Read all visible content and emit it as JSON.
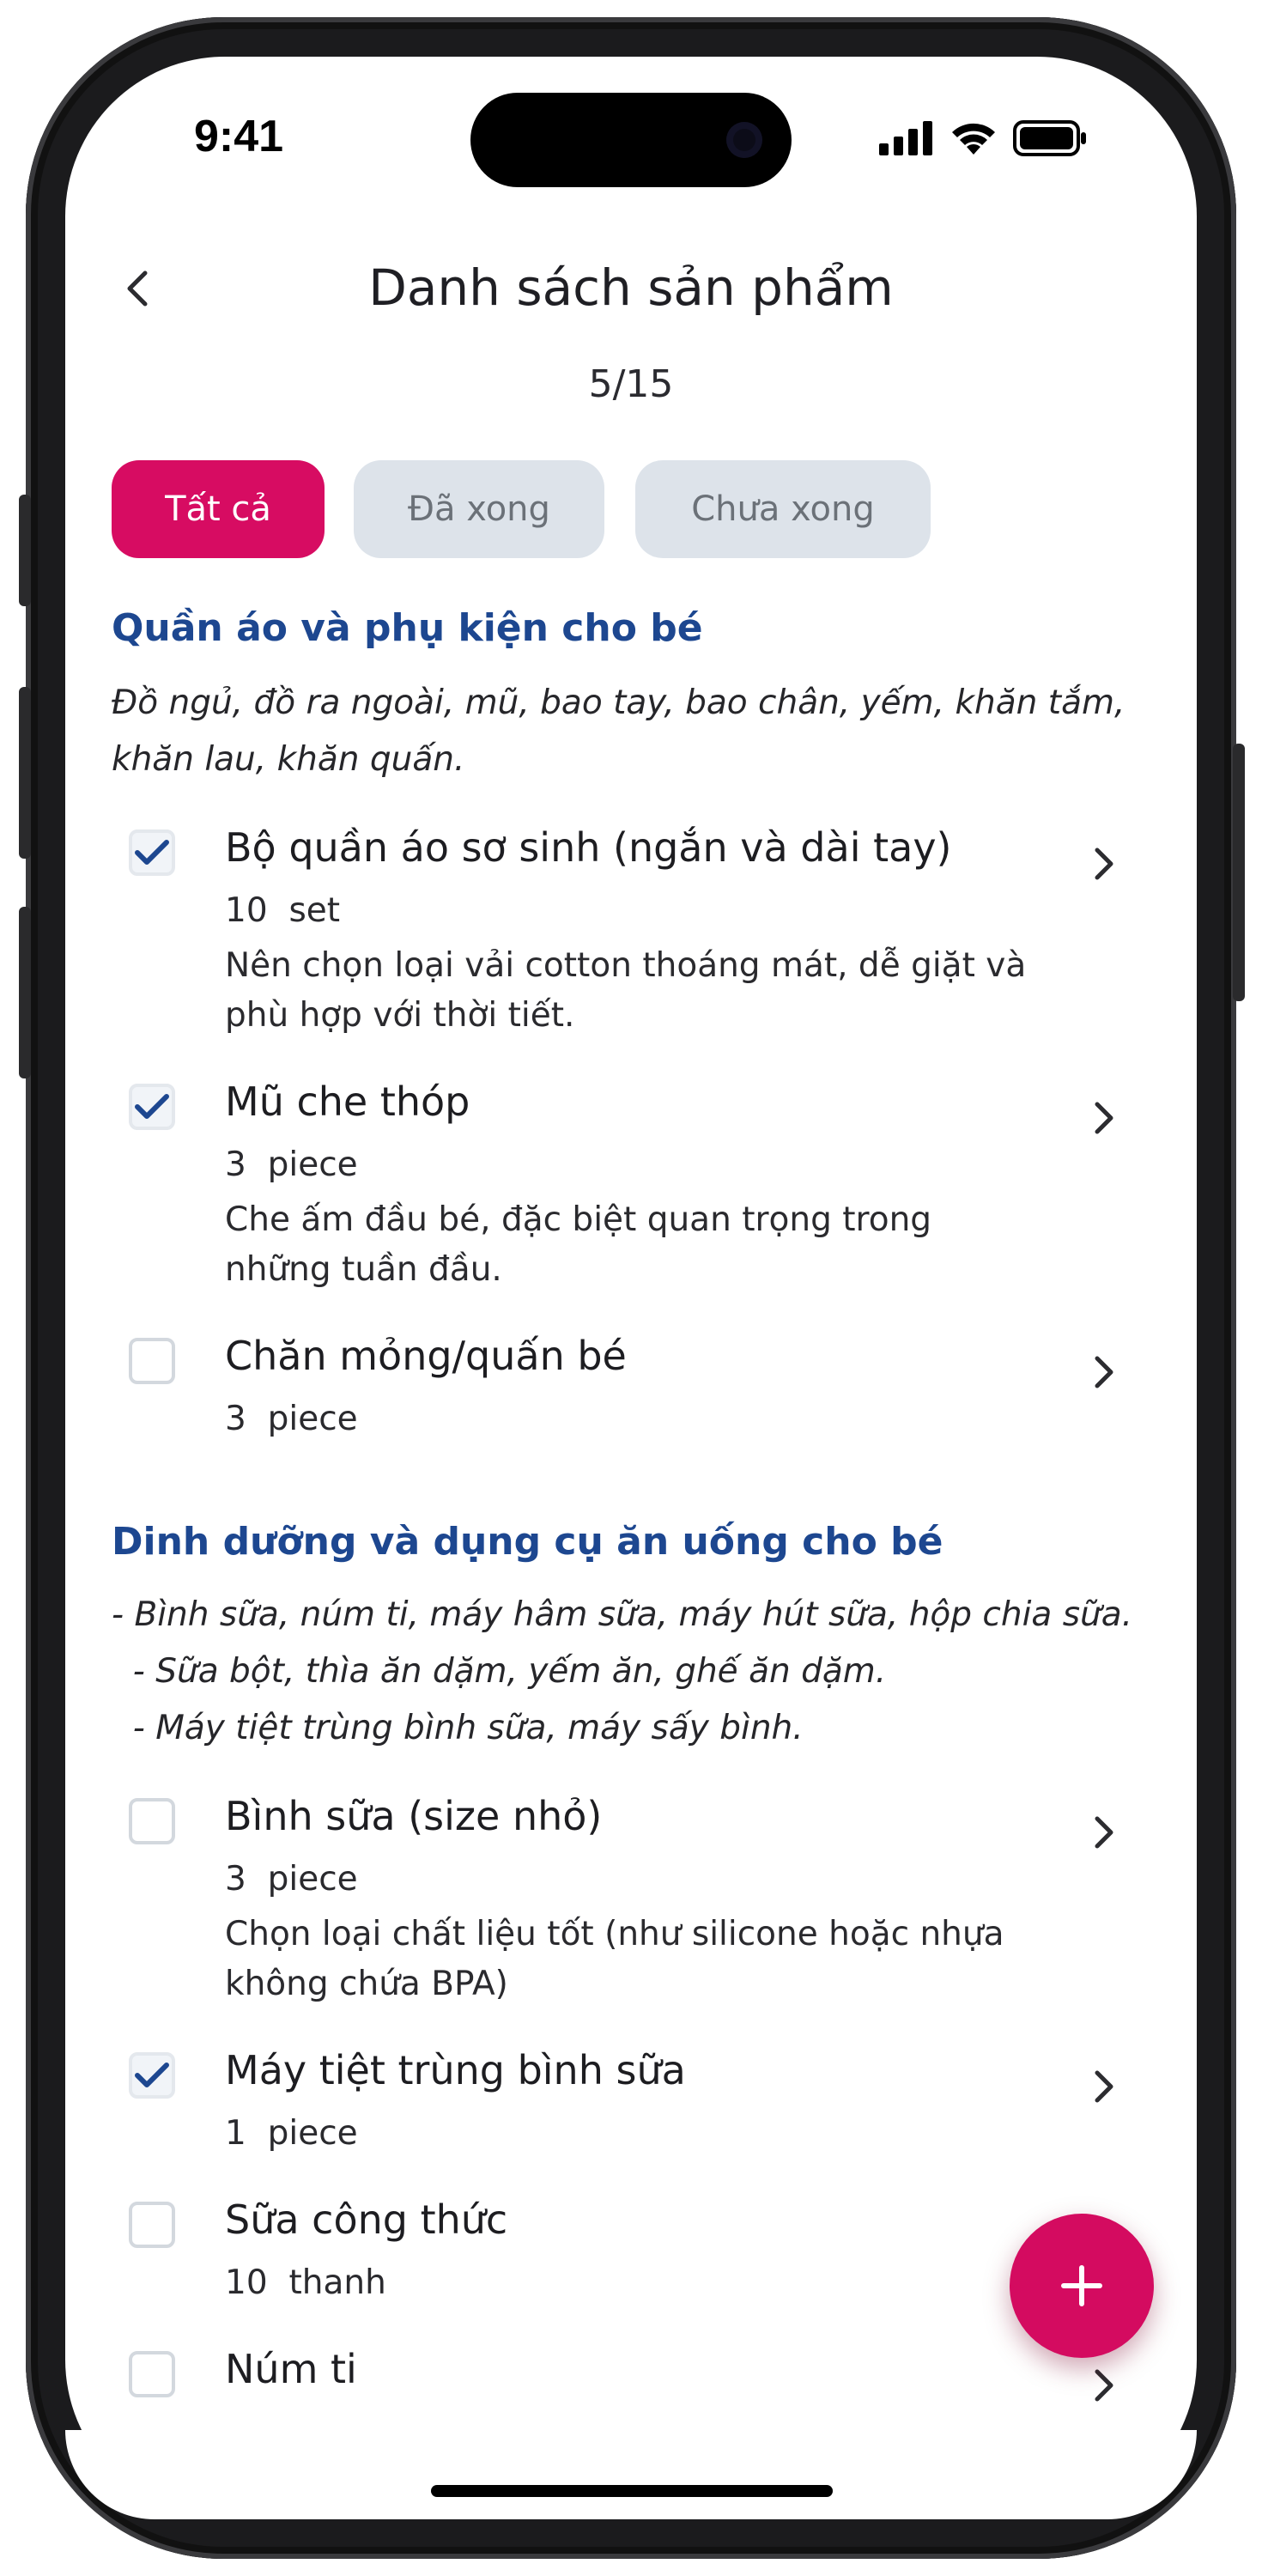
{
  "status_bar": {
    "time": "9:41"
  },
  "header": {
    "title": "Danh sách sản phẩm",
    "progress": "5/15"
  },
  "tabs": [
    {
      "label": "Tất cả",
      "active": true
    },
    {
      "label": "Đã xong",
      "active": false
    },
    {
      "label": "Chưa xong",
      "active": false
    }
  ],
  "sections": [
    {
      "title": "Quần áo và phụ kiện cho bé",
      "description_lines": [
        "Đồ ngủ, đồ ra ngoài, mũ, bao tay, bao chân, yếm, khăn tắm,",
        "khăn lau, khăn quấn."
      ],
      "items": [
        {
          "name": "Bộ quần áo sơ sinh (ngắn và dài tay)",
          "qty": "10",
          "unit": "set",
          "checked": true,
          "note_lines": [
            "Nên chọn loại vải cotton thoáng mát, dễ giặt và",
            "phù hợp với thời tiết."
          ]
        },
        {
          "name": "Mũ che thóp",
          "qty": "3",
          "unit": "piece",
          "checked": true,
          "note_lines": [
            "Che ấm đầu bé, đặc biệt quan trọng trong",
            "những tuần đầu."
          ]
        },
        {
          "name": "Chăn mỏng/quấn bé",
          "qty": "3",
          "unit": "piece",
          "checked": false,
          "note_lines": []
        }
      ]
    },
    {
      "title": "Dinh dưỡng và dụng cụ ăn uống cho bé",
      "description_lines": [
        "- Bình sữa, núm ti, máy hâm sữa, máy hút sữa, hộp chia sữa.",
        "  - Sữa bột, thìa ăn dặm, yếm ăn, ghế ăn dặm.",
        "  - Máy tiệt trùng bình sữa, máy sấy bình."
      ],
      "items": [
        {
          "name": "Bình sữa (size nhỏ)",
          "qty": "3",
          "unit": "piece",
          "checked": false,
          "note_lines": [
            "Chọn loại chất liệu tốt (như silicone hoặc nhựa",
            "không chứa BPA)"
          ]
        },
        {
          "name": "Máy tiệt trùng bình sữa",
          "qty": "1",
          "unit": "piece",
          "checked": true,
          "note_lines": []
        },
        {
          "name": "Sữa công thức",
          "qty": "10",
          "unit": "thanh",
          "checked": false,
          "note_lines": []
        },
        {
          "name": "Núm ti",
          "qty": "",
          "unit": "",
          "checked": false,
          "note_lines": []
        }
      ]
    }
  ],
  "fab": {
    "icon": "plus-icon"
  },
  "colors": {
    "accent": "#d70c62",
    "section_title": "#1d4790",
    "tab_inactive_bg": "#dde3ea",
    "check": "#1d4790"
  }
}
